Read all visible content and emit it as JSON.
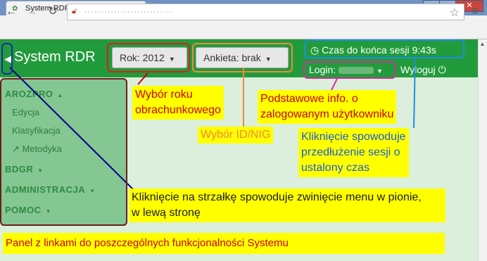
{
  "browser": {
    "tab_title": "System RDR Polskiego FADN",
    "tab_close": "✕",
    "url": "···························"
  },
  "app": {
    "brand": "System RDR",
    "year_dropdown": "Rok: 2012",
    "survey_dropdown": "Ankieta:  brak",
    "session_timer": "Czas do końca sesji 9:43s",
    "login_label": "Login:",
    "logout": "Wyloguj"
  },
  "sidebar": {
    "sections": [
      {
        "label": "AROZPRO",
        "expanded": true,
        "items": [
          "Edycja",
          "Klasyfikacja",
          "Metodyka"
        ]
      },
      {
        "label": "BDGR",
        "expanded": false,
        "items": []
      },
      {
        "label": "ADMINISTRACJA",
        "expanded": false,
        "items": []
      },
      {
        "label": "POMOC",
        "expanded": false,
        "items": []
      }
    ]
  },
  "annotations": {
    "year_line1": "Wybór roku",
    "year_line2": "obrachunkowego",
    "id_nig": "Wybór ID/NIG",
    "user_line1": "Podstawowe info. o",
    "user_line2": "zalogowanym użytkowniku",
    "session_line1": "Kliknięcie spowoduje",
    "session_line2": "przedłużenie sesji o",
    "session_line3": "ustalony czas",
    "collapse_line1": "Kliknięcie na strzałkę spowoduje zwinięcie menu w pionie,",
    "collapse_line2": "w lewą stronę",
    "panel": "Panel z linkami do poszczególnych funkcjonalności Systemu"
  },
  "colors": {
    "appbar": "#229b3c",
    "sidebar": "#84c792",
    "note_bg": "#ffff00",
    "note_red": "#cc0000",
    "note_orange": "#f08a3c",
    "note_blue": "#1c5fd6"
  }
}
